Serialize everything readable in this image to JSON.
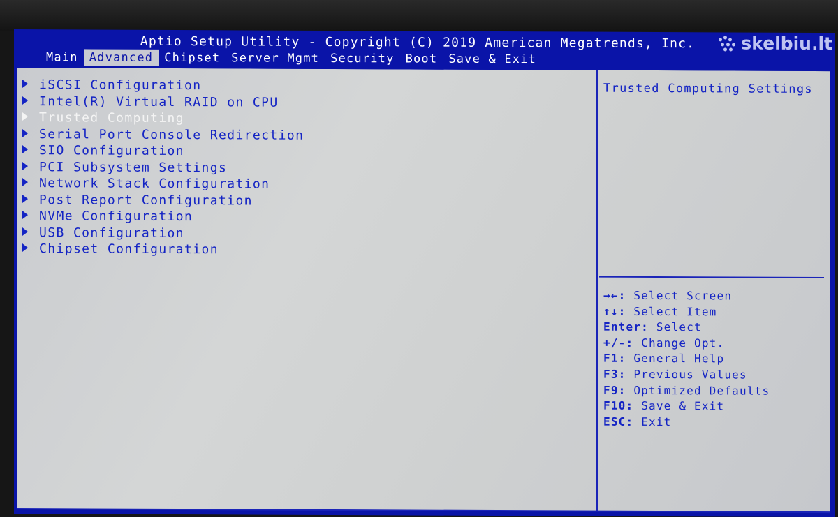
{
  "title": "Aptio Setup Utility - Copyright (C) 2019 American Megatrends, Inc.",
  "watermark": "skelbiu.lt",
  "tabs": [
    {
      "label": "Main",
      "active": false
    },
    {
      "label": "Advanced",
      "active": true
    },
    {
      "label": "Chipset",
      "active": false
    },
    {
      "label": "Server Mgmt",
      "active": false
    },
    {
      "label": "Security",
      "active": false
    },
    {
      "label": "Boot",
      "active": false
    },
    {
      "label": "Save & Exit",
      "active": false
    }
  ],
  "menu": [
    {
      "label": "iSCSI Configuration",
      "selected": false
    },
    {
      "label": "Intel(R) Virtual RAID on CPU",
      "selected": false
    },
    {
      "label": "Trusted Computing",
      "selected": true
    },
    {
      "label": "Serial Port Console Redirection",
      "selected": false
    },
    {
      "label": "SIO Configuration",
      "selected": false
    },
    {
      "label": "PCI Subsystem Settings",
      "selected": false
    },
    {
      "label": "Network Stack Configuration",
      "selected": false
    },
    {
      "label": "Post Report Configuration",
      "selected": false
    },
    {
      "label": "NVMe Configuration",
      "selected": false
    },
    {
      "label": "USB Configuration",
      "selected": false
    },
    {
      "label": "Chipset Configuration",
      "selected": false
    }
  ],
  "help": {
    "description": "Trusted Computing Settings"
  },
  "keys": [
    {
      "key": "→←:",
      "action": "Select Screen"
    },
    {
      "key": "↑↓:",
      "action": "Select Item"
    },
    {
      "key": "Enter:",
      "action": "Select"
    },
    {
      "key": "+/-:",
      "action": "Change Opt."
    },
    {
      "key": "F1:",
      "action": "General Help"
    },
    {
      "key": "F3:",
      "action": "Previous Values"
    },
    {
      "key": "F9:",
      "action": "Optimized Defaults"
    },
    {
      "key": "F10:",
      "action": "Save & Exit"
    },
    {
      "key": "ESC:",
      "action": "Exit"
    }
  ],
  "colors": {
    "frame_blue": "#0a14a8",
    "text_blue": "#1424c4",
    "panel_grey": "#cfd1d1",
    "highlight_text": "#f4f4f4"
  }
}
